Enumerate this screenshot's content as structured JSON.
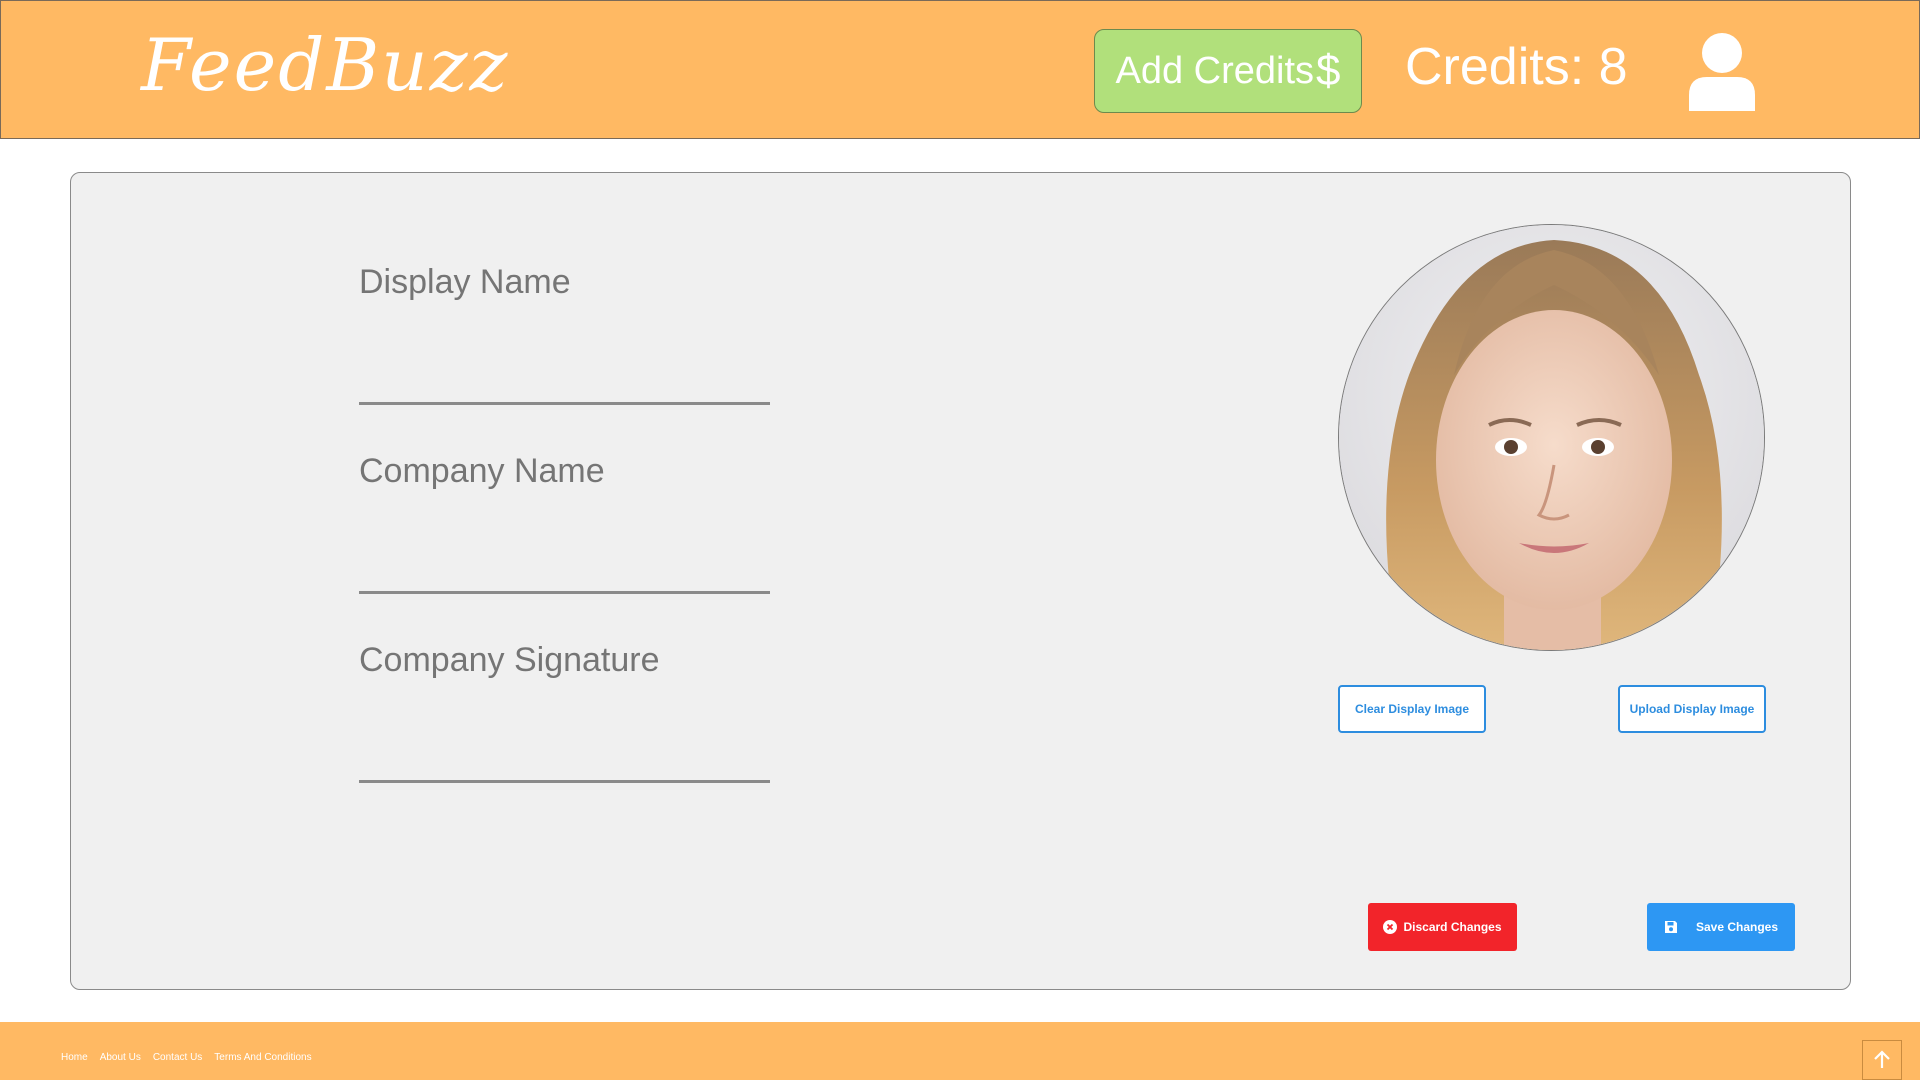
{
  "header": {
    "logo": "FeedBuzz",
    "add_credits_label": "Add Credits",
    "add_credits_symbol": "$",
    "credits_text": "Credits: 8",
    "user_icon": "user-icon"
  },
  "form": {
    "display_name": {
      "label": "Display Name",
      "value": ""
    },
    "company_name": {
      "label": "Company Name",
      "value": ""
    },
    "company_signature": {
      "label": "Company Signature",
      "value": ""
    }
  },
  "image": {
    "clear_label": "Clear Display Image",
    "upload_label": "Upload Display Image"
  },
  "actions": {
    "discard_label": "Discard Changes",
    "discard_icon": "close-circle-icon",
    "save_label": "Save Changes",
    "save_icon": "floppy-disk-icon"
  },
  "footer": {
    "links": [
      "Home",
      "About Us",
      "Contact Us",
      "Terms And Conditions"
    ],
    "scroll_top_icon": "arrow-up-icon"
  },
  "colors": {
    "brand": "#ffb963",
    "add_credits": "#b1e07b",
    "discard": "#f2242a",
    "save": "#2d97f3"
  }
}
